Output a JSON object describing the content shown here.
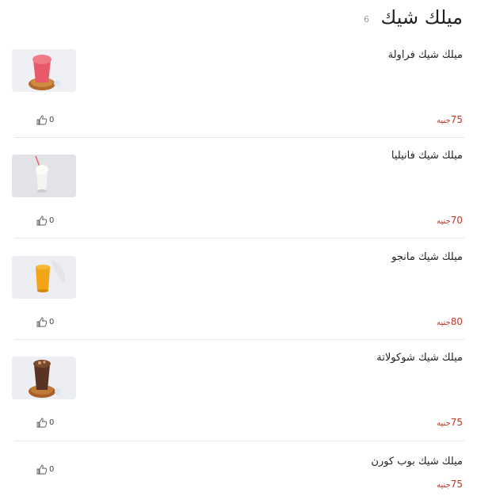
{
  "section": {
    "title": "ميلك شيك",
    "count": "6"
  },
  "currency": "جنيه",
  "colors": {
    "price": "#c0392b",
    "divider": "#e6e6e6"
  },
  "items": [
    {
      "name": "ميلك شيك فراولة",
      "price": "75",
      "likes": "0",
      "image": "strawberry-milkshake"
    },
    {
      "name": "ميلك شيك فانيليا",
      "price": "70",
      "likes": "0",
      "image": "vanilla-milkshake"
    },
    {
      "name": "ميلك شيك مانجو",
      "price": "80",
      "likes": "0",
      "image": "mango-milkshake"
    },
    {
      "name": "ميلك شيك شوكولاتة",
      "price": "75",
      "likes": "0",
      "image": "chocolate-milkshake"
    },
    {
      "name": "ميلك شيك بوب كورن",
      "price": "75",
      "likes": "0",
      "image": ""
    }
  ]
}
